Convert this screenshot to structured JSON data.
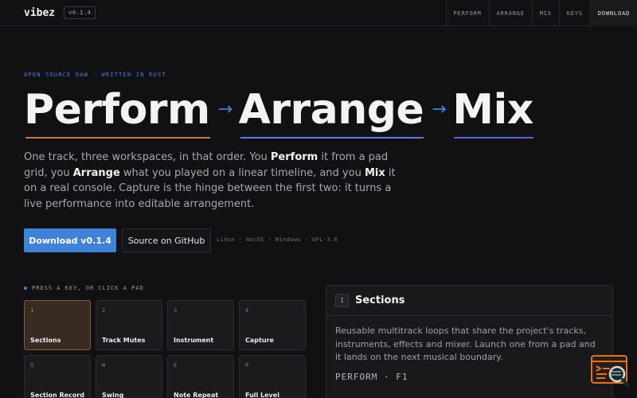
{
  "app": {
    "name": "vibez",
    "version": "v0.1.4"
  },
  "nav": {
    "items": [
      {
        "label": "PERFORM"
      },
      {
        "label": "ARRANGE"
      },
      {
        "label": "MIX"
      },
      {
        "label": "KEYS"
      },
      {
        "label": "DOWNLOAD"
      }
    ]
  },
  "hero": {
    "eyebrow": "OPEN SOURCE DAW · WRITTEN IN RUST",
    "words": [
      {
        "text": "Perform",
        "underline": "#c17a45"
      },
      {
        "text": "Arrange",
        "underline": "#5d7fe0"
      },
      {
        "text": "Mix",
        "underline": "#5a67c9"
      }
    ],
    "arrow": "→",
    "lead": [
      {
        "t": "One track, three workspaces, in that order. You ",
        "b": false
      },
      {
        "t": "Perform",
        "b": true
      },
      {
        "t": " it from a pad grid, you ",
        "b": false
      },
      {
        "t": "Arrange",
        "b": true
      },
      {
        "t": " what you played on a linear timeline, and you ",
        "b": false
      },
      {
        "t": "Mix",
        "b": true
      },
      {
        "t": " it on a real console. Capture is the hinge between the first two: it turns a live performance into editable arrangement.",
        "b": false
      }
    ],
    "download_label": "Download v0.1.4",
    "github_label": "Source on GitHub",
    "platforms": "Linux · macOS · Windows · GPL-3.0"
  },
  "pads": {
    "hint": "PRESS A KEY, OR CLICK A PAD",
    "items": [
      {
        "key": "1",
        "label": "Sections",
        "active": true
      },
      {
        "key": "2",
        "label": "Track Mutes",
        "active": false
      },
      {
        "key": "3",
        "label": "Instrument",
        "active": false
      },
      {
        "key": "4",
        "label": "Capture",
        "active": false
      },
      {
        "key": "Q",
        "label": "Section Record",
        "active": false
      },
      {
        "key": "W",
        "label": "Swing",
        "active": false
      },
      {
        "key": "E",
        "label": "Note Repeat",
        "active": false
      },
      {
        "key": "R",
        "label": "Full Level",
        "active": false
      }
    ]
  },
  "detail": {
    "number": "1",
    "title": "Sections",
    "body": "Reusable multitrack loops that share the project's tracks, instruments, effects and mixer. Launch one from a pad and it lands on the next musical boundary.",
    "shortcut": "PERFORM · F1"
  },
  "colors": {
    "accent": "#3f82d8",
    "background": "#111113",
    "active_pad": "#3a2b22"
  },
  "icons": {
    "helper": "terminal-search-icon"
  }
}
